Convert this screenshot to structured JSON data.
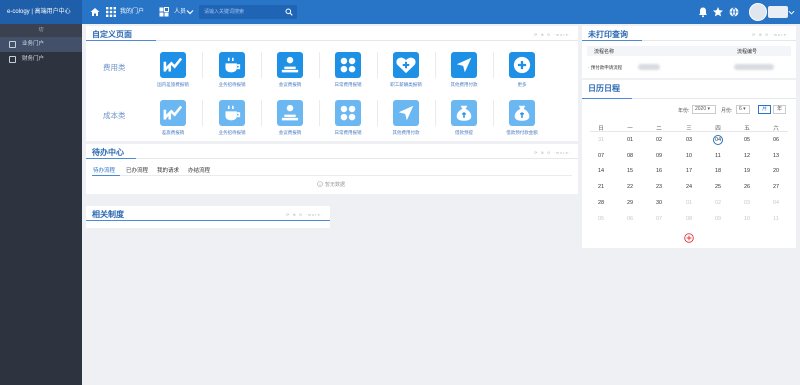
{
  "topbar": {
    "brand": "e-cology | 高端用户中心",
    "portal_label": "我的门户",
    "person_label": "人员",
    "search_placeholder": "请输入关键词搜索"
  },
  "sidebar": {
    "header": "切",
    "items": [
      {
        "label": "业务门户",
        "active": true
      },
      {
        "label": "财务门户",
        "active": false
      }
    ]
  },
  "custom_page": {
    "title": "自定义页面",
    "controls": "⟳ ⊕ ⊖ ·more·",
    "rows": [
      {
        "label": "费用类",
        "tiles": [
          {
            "icon": "chart-growth-icon",
            "label": "国内差旅费报销"
          },
          {
            "icon": "coffee-cup-icon",
            "label": "业务招待报销"
          },
          {
            "icon": "meeting-person-icon",
            "label": "会议费报销"
          },
          {
            "icon": "four-dots-icon",
            "label": "日常费用报销"
          },
          {
            "icon": "heart-plus-icon",
            "label": "职工薪酬类报销"
          },
          {
            "icon": "navigation-arrow-icon",
            "label": "其他费用付款"
          },
          {
            "icon": "plus-circle-icon",
            "label": "更多"
          }
        ]
      },
      {
        "label": "成本类",
        "tiles": [
          {
            "icon": "chart-growth-icon",
            "label": "差旅费报销"
          },
          {
            "icon": "coffee-cup-icon",
            "label": "业务招待报销"
          },
          {
            "icon": "meeting-person-icon",
            "label": "会议费报销"
          },
          {
            "icon": "four-dots-icon",
            "label": "日常费用报销"
          },
          {
            "icon": "navigation-arrow-icon",
            "label": "其他费用付款"
          },
          {
            "icon": "money-bag-icon",
            "label": "借款预提"
          },
          {
            "icon": "money-bag-icon",
            "label": "借款预付款金额"
          }
        ]
      }
    ]
  },
  "todo": {
    "title": "待办中心",
    "controls": "⟳ ⊕ ⊖ ·more·",
    "tabs": [
      "待办流程",
      "已办流程",
      "我的请求",
      "办结流程"
    ],
    "empty_text": "暂无数据"
  },
  "rules": {
    "title": "相关制度",
    "controls": "⟳ ⊕ ⊖ ·more·"
  },
  "unprinted": {
    "title": "未打印查询",
    "controls": "⟳ ⊕ ⊖ ·more·",
    "col1": "流程名称",
    "col2": "流程编号",
    "row1_name": "· 预付款申请流程"
  },
  "calendar": {
    "title": "日历日程",
    "year_label": "年份:",
    "year_value": "2020",
    "month_label": "月份:",
    "month_value": "6",
    "btn_month": "月",
    "btn_year": "年",
    "weekdays": [
      "日",
      "一",
      "二",
      "三",
      "四",
      "五",
      "六"
    ],
    "weeks": [
      [
        "31",
        "01",
        "02",
        "03",
        "04",
        "05",
        "06"
      ],
      [
        "07",
        "08",
        "09",
        "10",
        "11",
        "12",
        "13"
      ],
      [
        "14",
        "15",
        "16",
        "17",
        "18",
        "19",
        "20"
      ],
      [
        "21",
        "22",
        "23",
        "24",
        "25",
        "26",
        "27"
      ],
      [
        "28",
        "29",
        "30",
        "01",
        "02",
        "03",
        "04"
      ],
      [
        "05",
        "06",
        "07",
        "08",
        "09",
        "10",
        "11"
      ]
    ],
    "today": "04",
    "add_icon": "add-circle-icon"
  },
  "colors": {
    "topbar": "#2874c6",
    "sidebar": "#2d3440",
    "tile": "#1e90e6",
    "tile_light": "#6ab7f2",
    "accent": "#2a68b2",
    "add": "#e0343a"
  }
}
